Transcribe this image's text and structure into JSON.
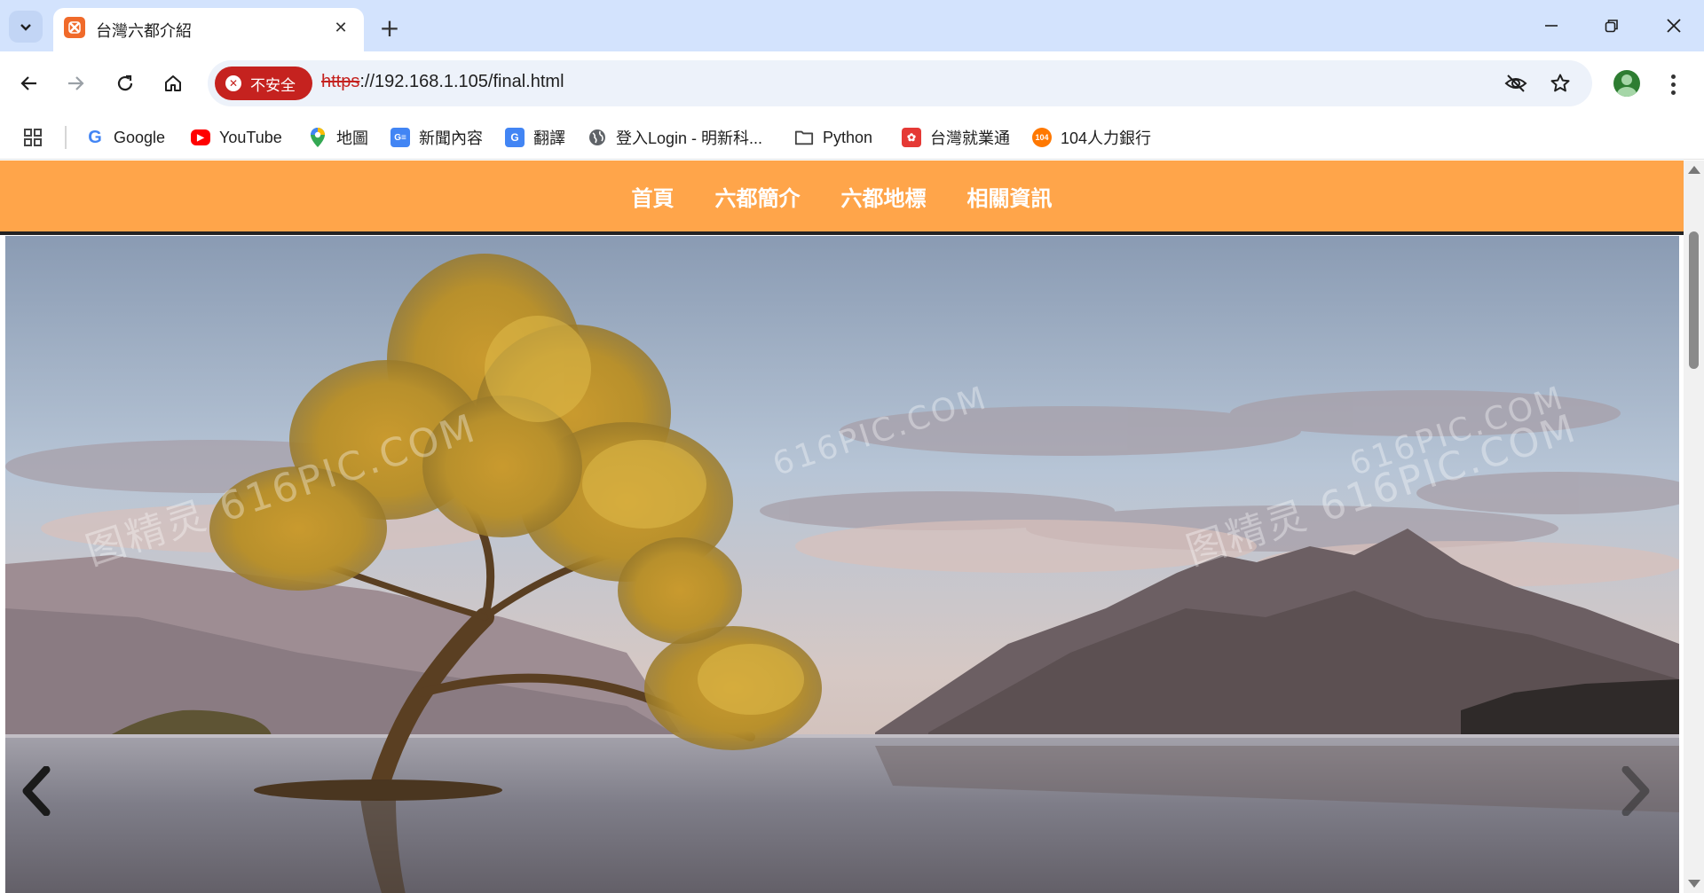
{
  "browser": {
    "tab": {
      "title": "台灣六都介紹"
    },
    "address_bar": {
      "security_label": "不安全",
      "url_scheme": "https",
      "url_rest": "://192.168.1.105/final.html"
    },
    "bookmarks": [
      {
        "label": "Google",
        "icon": "google-icon"
      },
      {
        "label": "YouTube",
        "icon": "youtube-icon"
      },
      {
        "label": "地圖",
        "icon": "maps-icon"
      },
      {
        "label": "新聞內容",
        "icon": "news-icon"
      },
      {
        "label": "翻譯",
        "icon": "translate-icon"
      },
      {
        "label": "登入Login - 明新科...",
        "icon": "globe-icon"
      },
      {
        "label": "Python",
        "icon": "folder-icon"
      },
      {
        "label": "台灣就業通",
        "icon": "job-icon"
      },
      {
        "label": "104人力銀行",
        "icon": "104-icon"
      }
    ]
  },
  "site": {
    "nav": [
      "首頁",
      "六都簡介",
      "六都地標",
      "相關資訊"
    ],
    "nav_color": "#ffa54a",
    "watermarks": [
      "图精灵 616PIC.COM",
      "图精灵 616PIC.COM",
      "616PIC.COM",
      "616PIC.COM"
    ]
  }
}
